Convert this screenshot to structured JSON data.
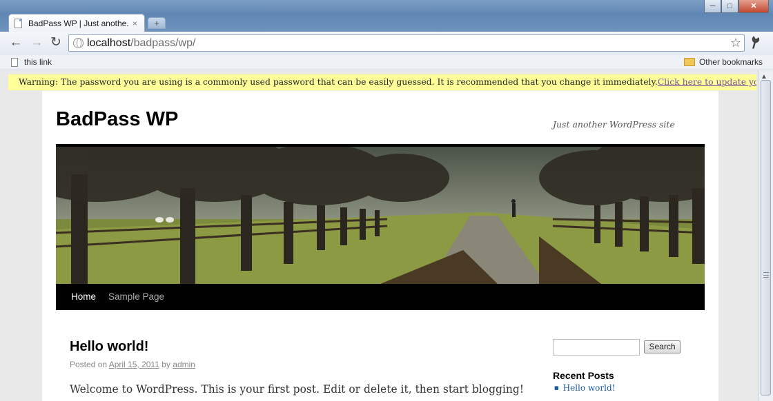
{
  "browser": {
    "tab_title": "BadPass WP | Just anothe...",
    "tab_close": "×",
    "new_tab": "+",
    "window_controls": [
      "─",
      "□",
      "✕"
    ],
    "back_icon": "←",
    "forward_icon": "→",
    "reload_icon": "↻",
    "address_host": "localhost",
    "address_path": "/badpass/wp/",
    "star_icon": "☆",
    "wrench_icon": "🔧",
    "bookmark": "this link",
    "other_bookmarks": "Other bookmarks"
  },
  "warning": {
    "text": "Warning: The password you are using is a commonly used password that can be easily guessed. It is recommended that you change it immediately.",
    "link": "Click here to update your password."
  },
  "site": {
    "title": "BadPass WP",
    "tagline": "Just another WordPress site"
  },
  "nav": {
    "items": [
      "Home",
      "Sample Page"
    ]
  },
  "post": {
    "title": "Hello world!",
    "posted_on": "Posted on",
    "date": "April 15, 2011",
    "by": "by",
    "author": "admin",
    "body": "Welcome to WordPress. This is your first post. Edit or delete it, then start blogging!"
  },
  "sidebar": {
    "search_button": "Search",
    "recent_posts_title": "Recent Posts",
    "recent_posts": [
      "Hello world!"
    ]
  },
  "colors": {
    "warning_bg": "#ffff99",
    "nav_bg": "#000000",
    "link": "#1a5aa3"
  }
}
